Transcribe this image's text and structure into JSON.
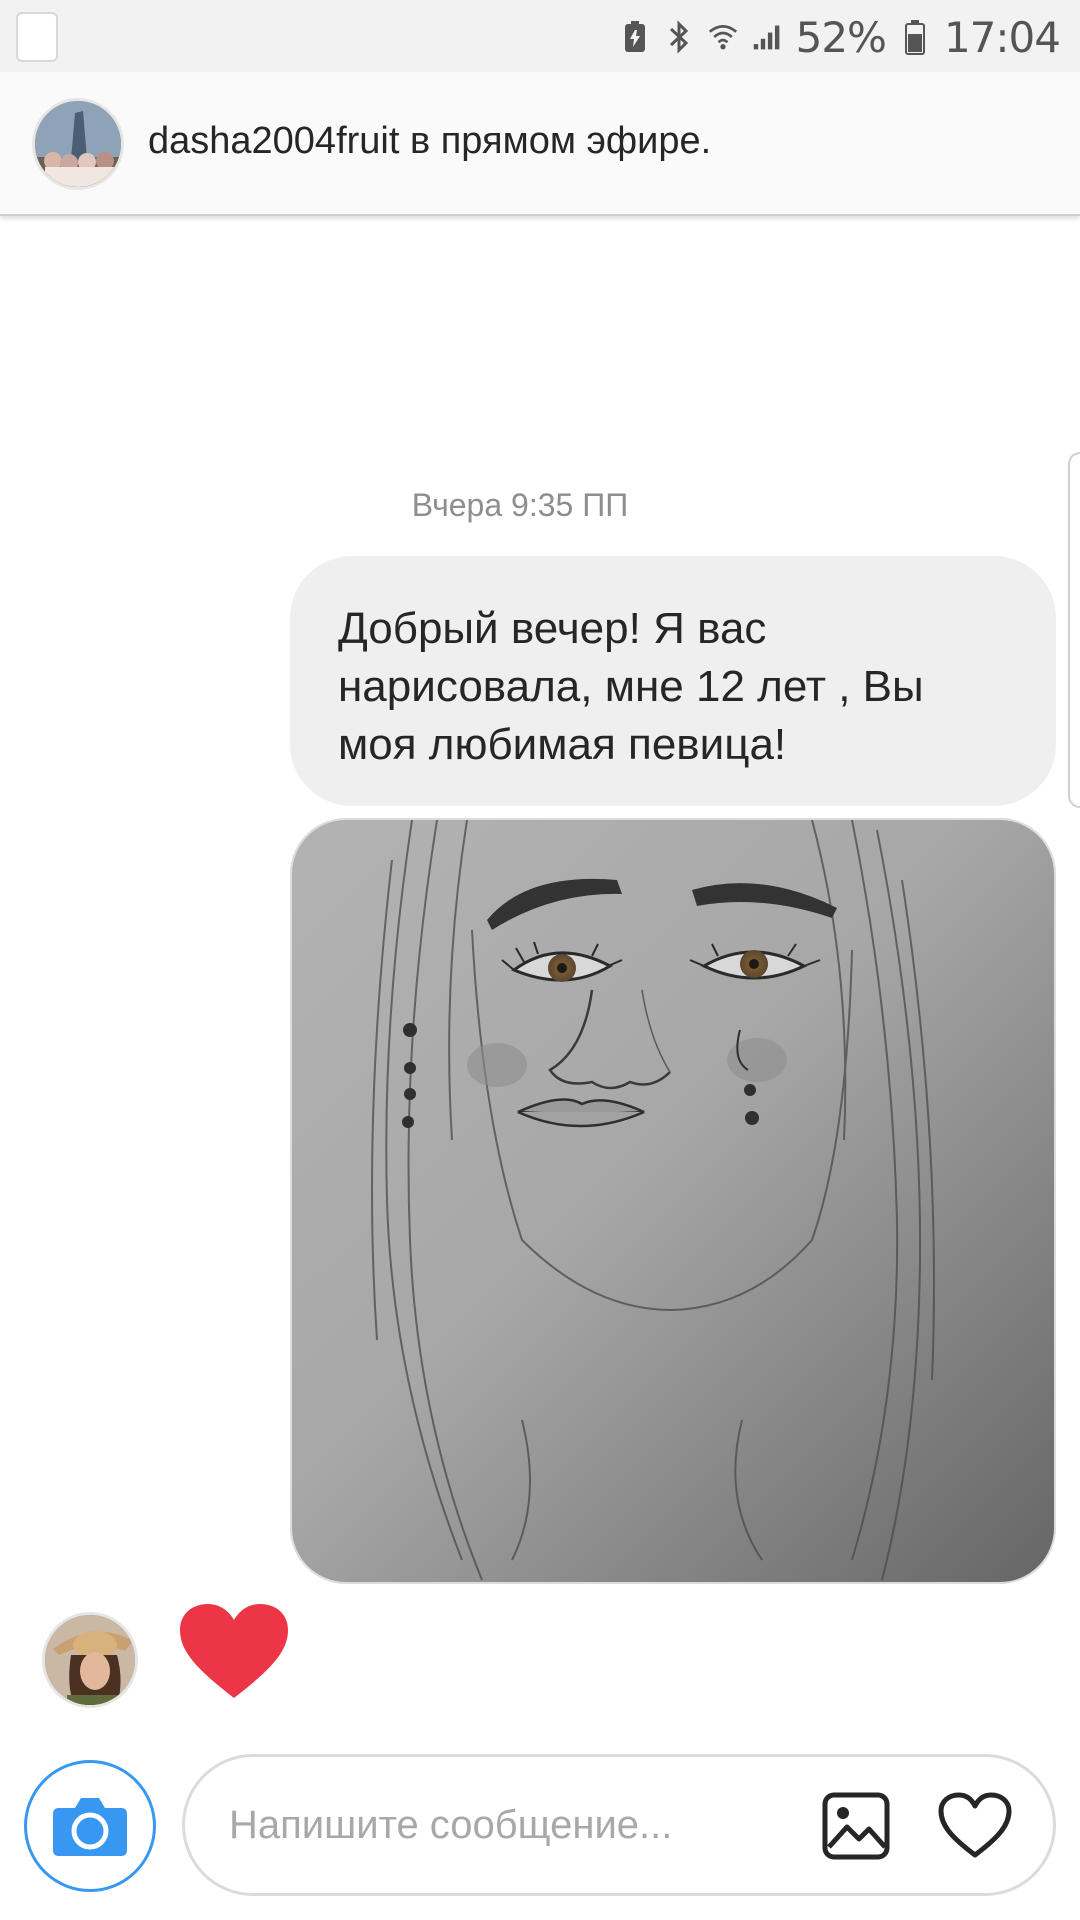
{
  "status_bar": {
    "battery_percent": "52%",
    "time": "17:04",
    "icons": [
      "battery-saver-icon",
      "bluetooth-icon",
      "wifi-icon",
      "signal-icon",
      "battery-icon"
    ]
  },
  "live_banner": {
    "username": "dasha2004fruit",
    "message": "dasha2004fruit в прямом эфире."
  },
  "thread": {
    "timestamp": "Вчера 9:35 ПП",
    "message_text": "Добрый вечер!  Я вас нарисовала, мне 12 лет , Вы моя любимая певица!",
    "attachment": "pencil-portrait-drawing",
    "reaction": "heart"
  },
  "composer": {
    "placeholder": "Напишите сообщение...",
    "icons": [
      "camera-icon",
      "gallery-icon",
      "heart-icon"
    ]
  },
  "colors": {
    "accent_blue": "#3897f0",
    "heart_red": "#ed3645",
    "bubble_gray": "#efefef",
    "meta_gray": "#8e8e8e"
  }
}
